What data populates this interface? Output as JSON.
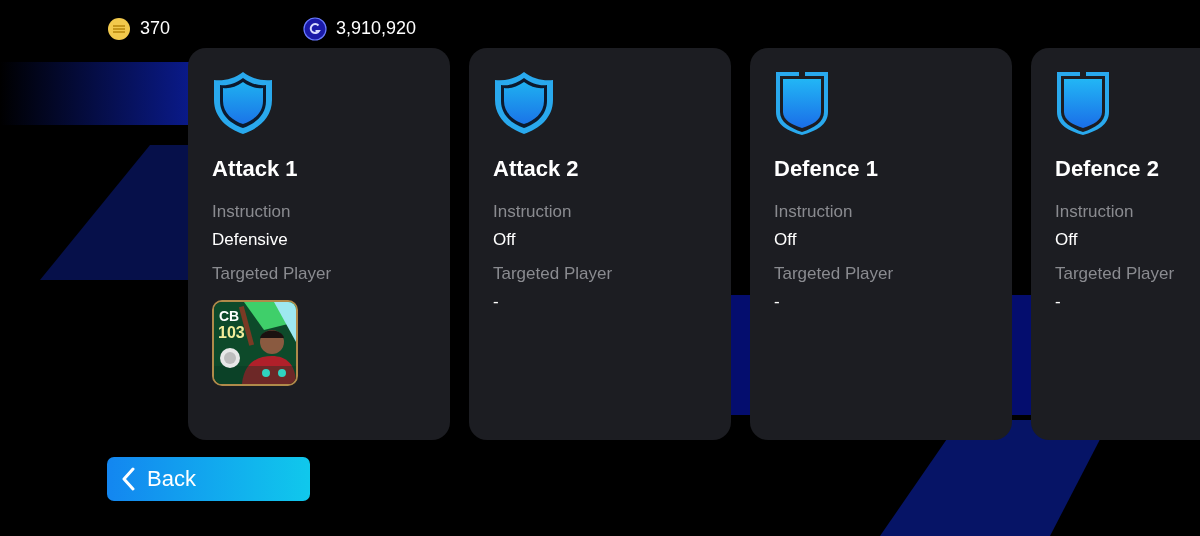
{
  "currencies": [
    {
      "kind": "coin",
      "amount": "370"
    },
    {
      "kind": "gp",
      "amount": "3,910,920"
    }
  ],
  "cards": [
    {
      "kind": "attack",
      "title": "Attack 1",
      "instruction_label": "Instruction",
      "instruction": "Defensive",
      "target_label": "Targeted Player",
      "player": {
        "position": "CB",
        "rating": "103"
      }
    },
    {
      "kind": "attack",
      "title": "Attack 2",
      "instruction_label": "Instruction",
      "instruction": "Off",
      "target_label": "Targeted Player",
      "target": "-"
    },
    {
      "kind": "defence",
      "title": "Defence 1",
      "instruction_label": "Instruction",
      "instruction": "Off",
      "target_label": "Targeted Player",
      "target": "-"
    },
    {
      "kind": "defence",
      "title": "Defence 2",
      "instruction_label": "Instruction",
      "instruction": "Off",
      "target_label": "Targeted Player",
      "target": "-"
    }
  ],
  "back_button": {
    "label": "Back"
  }
}
